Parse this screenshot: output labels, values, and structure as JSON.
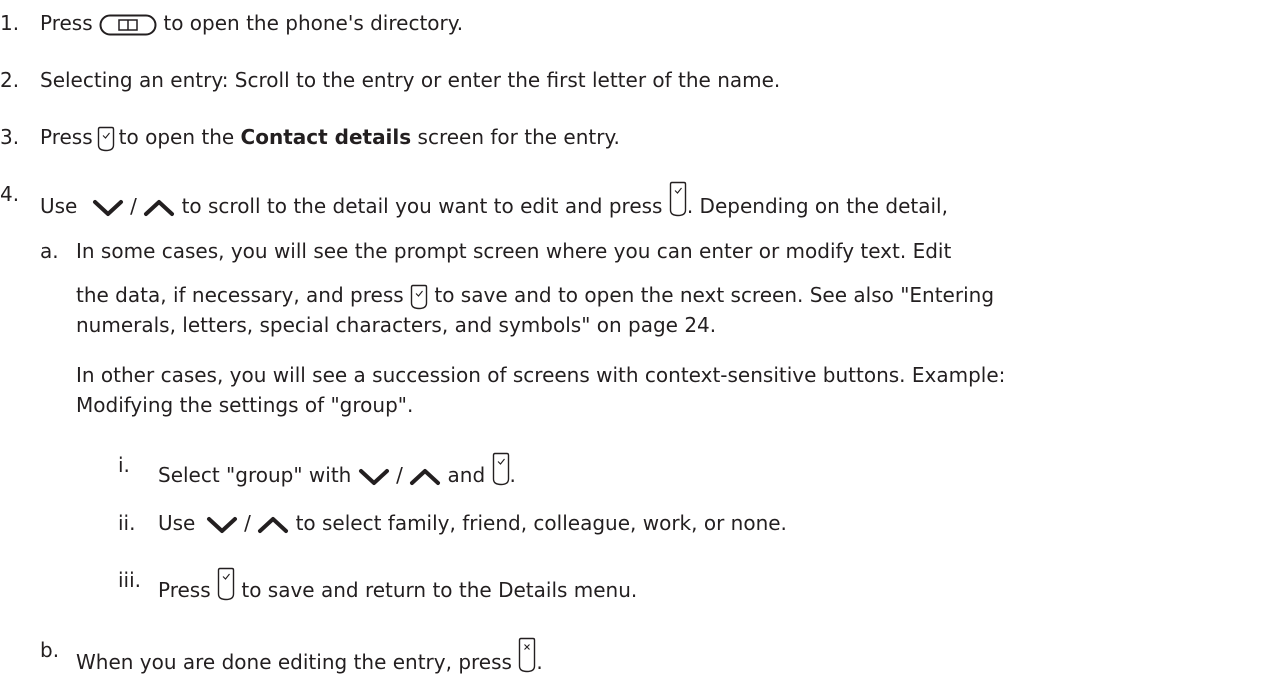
{
  "steps": [
    {
      "num": "1.",
      "a": "Press",
      "b": "to open the phone's directory."
    },
    {
      "num": "2.",
      "a": "Selecting an entry:  Scroll to the entry or enter the first letter of the name."
    },
    {
      "num": "3.",
      "a": "Press",
      "b": "to open the",
      "bold": "Contact details",
      "c": "screen for the entry."
    },
    {
      "num": "4.",
      "a": "Use",
      "sep": "/",
      "b": "to scroll to the detail you want to edit and press",
      "c": ". Depending on the detail,"
    }
  ],
  "sub_a": {
    "num": "a.",
    "line1": "In some cases, you will see the prompt screen where you can enter or modify text.  Edit",
    "line2a": "the data, if necessary, and press",
    "line2b": "to save and to open the next screen.  See also \"Entering",
    "line3": "numerals, letters, special characters, and symbols\" on page 24.",
    "line4": "In other cases, you will see a succession of screens with context-sensitive buttons.  Example:",
    "line5": "Modifying the settings of \"group\"."
  },
  "roman": [
    {
      "num": "i.",
      "a": "Select \"group\" with",
      "sep": "/",
      "b": "and",
      "c": "."
    },
    {
      "num": "ii.",
      "a": "Use",
      "sep": "/",
      "b": "to select family, friend, colleague, work, or none."
    },
    {
      "num": "iii.",
      "a": "Press",
      "b": "to save and return to the Details menu."
    }
  ],
  "sub_b": {
    "num": "b.",
    "a": "When you are done editing the entry, press",
    "b": "."
  },
  "icons": [
    "directory-key-icon",
    "ok-key-icon",
    "down-arrow-icon",
    "up-arrow-icon",
    "cancel-key-icon"
  ]
}
